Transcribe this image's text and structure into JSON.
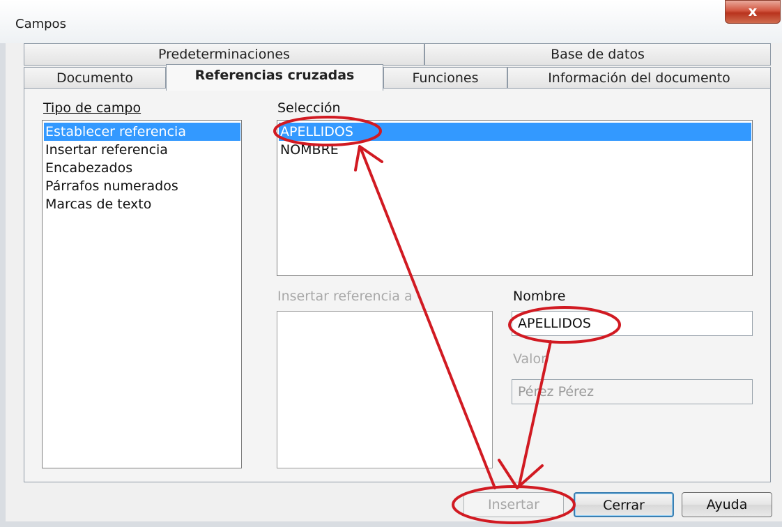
{
  "window": {
    "title": "Campos",
    "close_glyph": "x"
  },
  "tabs": {
    "back": [
      "Predeterminaciones",
      "Base de datos"
    ],
    "front": [
      "Documento",
      "Referencias cruzadas",
      "Funciones",
      "Información del documento"
    ],
    "active": "Referencias cruzadas"
  },
  "field_type": {
    "label": "Tipo de campo",
    "items": [
      "Establecer referencia",
      "Insertar referencia",
      "Encabezados",
      "Párrafos numerados",
      "Marcas de texto"
    ],
    "selected_index": 0
  },
  "selection": {
    "label": "Selección",
    "items": [
      "APELLIDOS",
      "NOMBRE"
    ],
    "selected_index": 0
  },
  "insert_ref": {
    "label": "Insertar referencia a"
  },
  "name": {
    "label": "Nombre",
    "value": "APELLIDOS"
  },
  "value": {
    "label": "Valor",
    "value": "Pérez Pérez"
  },
  "buttons": {
    "insert": "Insertar",
    "close": "Cerrar",
    "help": "Ayuda"
  },
  "colors": {
    "annotation": "#d11a22",
    "selection": "#3399ff"
  }
}
